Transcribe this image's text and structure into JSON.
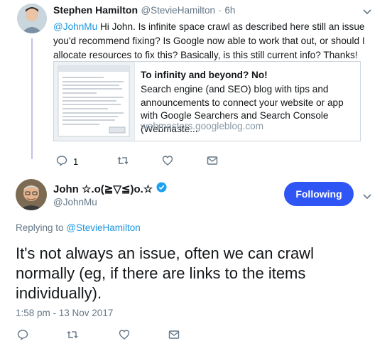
{
  "reply": {
    "author_name": "Stephen Hamilton",
    "author_handle": "@StevieHamilton",
    "separator": "·",
    "time": "6h",
    "mention": "@JohnMu",
    "text": " Hi John. Is infinite space crawl as described here still an issue you'd recommend fixing? Is Google now able to work that out, or should I allocate resources to fix this? Basically, is this still current info? Thanks!",
    "card": {
      "title": "To infinity and beyond? No!",
      "description": "Search engine (and SEO) blog with tips and announcements to connect your website or app with Google Searchers and Search Console (Webmaste...",
      "url": "webmasters.googleblog.com"
    },
    "reply_count": "1"
  },
  "main": {
    "author_name": "John ☆.o(≧▽≦)o.☆",
    "author_handle": "@JohnMu",
    "follow_label": "Following",
    "replying_to_label": "Replying to",
    "replying_to_handle": "@StevieHamilton",
    "text": "It's not always an issue, often we can crawl normally (eg, if there are links to the items individually).",
    "timestamp": "1:58 pm - 13 Nov 2017"
  },
  "colors": {
    "accent": "#1b95e0",
    "follow_button": "#2f55f5",
    "verified": "#1da1f2"
  },
  "icons": [
    "reply-icon",
    "retweet-icon",
    "like-icon",
    "dm-icon",
    "chevron-down-icon",
    "verified-badge-icon"
  ]
}
